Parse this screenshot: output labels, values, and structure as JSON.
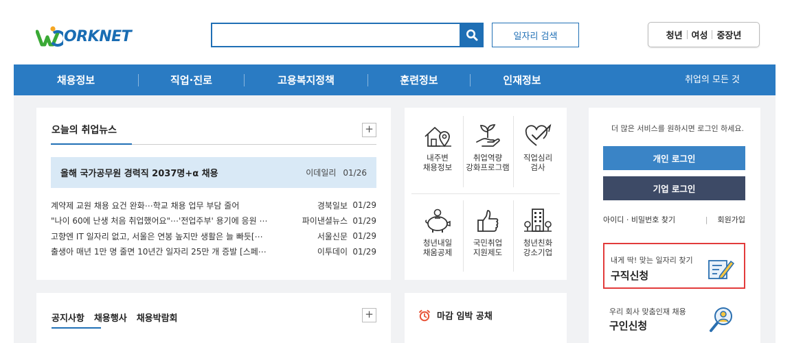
{
  "header": {
    "logo_text": "ORKNET",
    "search_placeholder": "",
    "job_search_label": "일자리 검색",
    "groups": [
      "청년",
      "여성",
      "중장년"
    ]
  },
  "nav": {
    "items": [
      "채용정보",
      "직업·진로",
      "고용복지정책",
      "훈련정보",
      "인재정보"
    ],
    "right": "취업의 모든 것"
  },
  "news": {
    "title": "오늘의 취업뉴스",
    "plus": "+",
    "headline": {
      "title": "올해 국가공무원 경력직 2037명+α 채용",
      "source": "이데일리",
      "date": "01/26"
    },
    "items": [
      {
        "title": "계약제 교원 채용 요건 완화⋯학교 채용 업무 부담 줄어",
        "source": "경북일보",
        "date": "01/29"
      },
      {
        "title": "\"나이 60에 난생 처음 취업했어요\"⋯'전업주부' 용기에 응원 ⋯",
        "source": "파이낸셜뉴스",
        "date": "01/29"
      },
      {
        "title": "고향엔 IT 일자리 없고, 서울은 연봉 높지만 생활은 늘 빠듯[⋯",
        "source": "서울신문",
        "date": "01/29"
      },
      {
        "title": "출생아 매년 1만 명 줄면 10년간 일자리 25만 개 증발 [스페⋯",
        "source": "이투데이",
        "date": "01/29"
      }
    ]
  },
  "notice": {
    "tabs": [
      "공지사항",
      "채용행사",
      "채용박람회"
    ],
    "plus": "+"
  },
  "services": [
    {
      "label": "내주변\n채용정보",
      "icon": "house-location-icon"
    },
    {
      "label": "취업역량\n강화프로그램",
      "icon": "sprout-hand-icon"
    },
    {
      "label": "직업심리\n검사",
      "icon": "heart-check-icon"
    },
    {
      "label": "청년내일\n채움공제",
      "icon": "piggy-bank-icon"
    },
    {
      "label": "국민취업\n지원제도",
      "icon": "thumbs-up-icon"
    },
    {
      "label": "청년친화\n강소기업",
      "icon": "building-icon"
    }
  ],
  "deadline": {
    "title": "마감 임박 공채",
    "icon": "alarm-clock-icon"
  },
  "login": {
    "message": "더 많은 서비스를 원하시면 로그인 하세요.",
    "personal_label": "개인 로그인",
    "company_label": "기업 로그인",
    "find_label": "아이디 · 비밀번호 찾기",
    "join_label": "회원가입"
  },
  "promos": [
    {
      "sub": "내게 딱! 맞는 일자리 찾기",
      "title": "구직신청",
      "icon": "document-pen-icon"
    },
    {
      "sub": "우리 회사 맞춤인재 채용",
      "title": "구인신청",
      "icon": "person-search-icon"
    }
  ],
  "colors": {
    "brand_blue": "#2a7bc3",
    "personal_login": "#3a84c6",
    "company_login": "#3d4a66",
    "highlight_border": "#e23a3a",
    "logo_green": "#3aa935"
  }
}
